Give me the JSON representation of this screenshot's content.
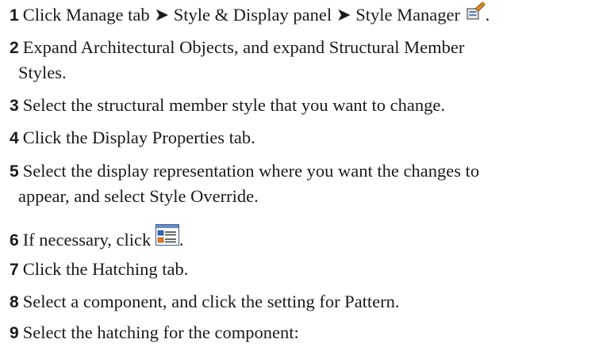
{
  "steps": [
    {
      "number": "1",
      "text": "Click Manage tab ➤ Style & Display panel ➤ Style Manager",
      "tail": ".",
      "icon": "style-manager-icon"
    },
    {
      "number": "2",
      "line1": "Expand Architectural Objects, and expand Structural Member",
      "line2": "Styles."
    },
    {
      "number": "3",
      "text": "Select the structural member style that you want to change."
    },
    {
      "number": "4",
      "text": "Click the Display Properties tab."
    },
    {
      "number": "5",
      "line1": "Select the display representation where you want the changes to",
      "line2": "appear, and select Style Override."
    },
    {
      "number": "6",
      "text": "If necessary, click",
      "tail": ".",
      "icon": "style-override-icon"
    },
    {
      "number": "7",
      "text": "Click the Hatching tab."
    },
    {
      "number": "8",
      "text": "Select a component, and click the setting for Pattern."
    },
    {
      "number": "9",
      "text": "Select the hatching for the component:"
    }
  ]
}
